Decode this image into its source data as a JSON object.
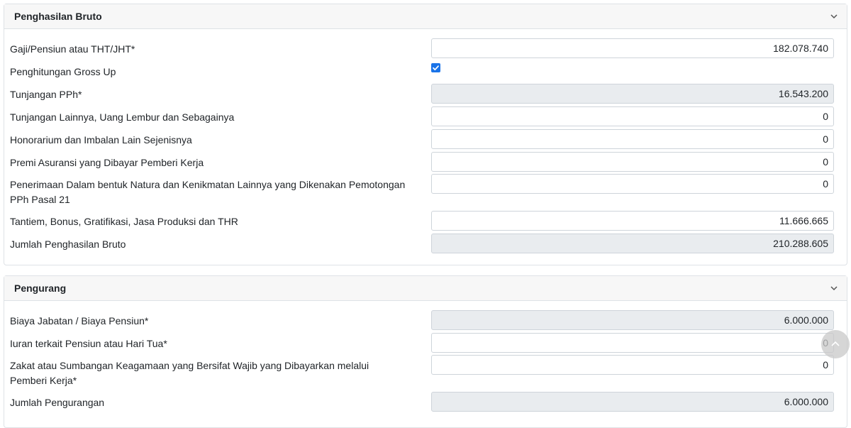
{
  "section_bruto": {
    "title": "Penghasilan Bruto",
    "rows": [
      {
        "label": "Gaji/Pensiun atau THT/JHT*",
        "value": "182.078.740",
        "readonly": false
      },
      {
        "label": "Penghitungan Gross Up",
        "checked": true
      },
      {
        "label": "Tunjangan PPh*",
        "value": "16.543.200",
        "readonly": true
      },
      {
        "label": "Tunjangan Lainnya, Uang Lembur dan Sebagainya",
        "value": "0",
        "readonly": false
      },
      {
        "label": "Honorarium dan Imbalan Lain Sejenisnya",
        "value": "0",
        "readonly": false
      },
      {
        "label": "Premi Asuransi yang Dibayar Pemberi Kerja",
        "value": "0",
        "readonly": false
      },
      {
        "label": "Penerimaan Dalam bentuk Natura dan Kenikmatan Lainnya yang Dikenakan Pemotongan PPh Pasal 21",
        "value": "0",
        "readonly": false
      },
      {
        "label": "Tantiem, Bonus, Gratifikasi, Jasa Produksi dan THR",
        "value": "11.666.665",
        "readonly": false
      },
      {
        "label": "Jumlah Penghasilan Bruto",
        "value": "210.288.605",
        "readonly": true
      }
    ]
  },
  "section_pengurang": {
    "title": "Pengurang",
    "rows": [
      {
        "label": "Biaya Jabatan / Biaya Pensiun*",
        "value": "6.000.000",
        "readonly": true
      },
      {
        "label": "Iuran terkait Pensiun atau Hari Tua*",
        "value": "0",
        "readonly": false
      },
      {
        "label": "Zakat atau Sumbangan Keagamaan yang Bersifat Wajib yang Dibayarkan melalui Pemberi Kerja*",
        "value": "0",
        "readonly": false
      },
      {
        "label": "Jumlah Pengurangan",
        "value": "6.000.000",
        "readonly": true
      }
    ]
  },
  "colors": {
    "checkbox": "#1a73e8",
    "readonly_bg": "#e9ecef",
    "header_bg": "#f7f7f7"
  },
  "icons": [
    "chevron-down-icon",
    "check-icon",
    "arrow-up-icon"
  ]
}
